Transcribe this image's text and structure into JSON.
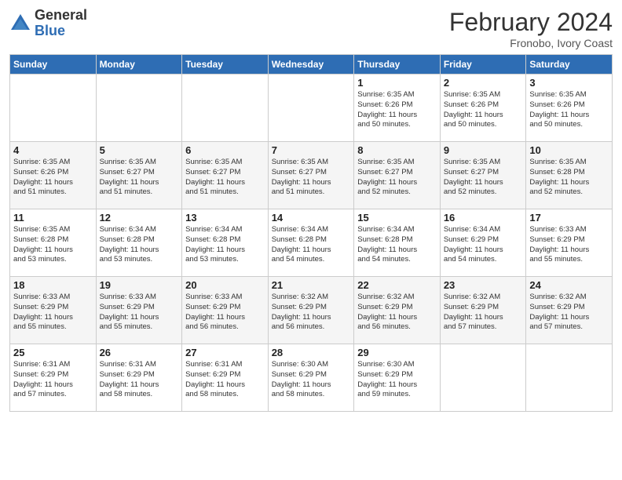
{
  "header": {
    "logo_general": "General",
    "logo_blue": "Blue",
    "month_title": "February 2024",
    "subtitle": "Fronobo, Ivory Coast"
  },
  "days_of_week": [
    "Sunday",
    "Monday",
    "Tuesday",
    "Wednesday",
    "Thursday",
    "Friday",
    "Saturday"
  ],
  "weeks": [
    [
      {
        "day": "",
        "info": ""
      },
      {
        "day": "",
        "info": ""
      },
      {
        "day": "",
        "info": ""
      },
      {
        "day": "",
        "info": ""
      },
      {
        "day": "1",
        "info": "Sunrise: 6:35 AM\nSunset: 6:26 PM\nDaylight: 11 hours\nand 50 minutes."
      },
      {
        "day": "2",
        "info": "Sunrise: 6:35 AM\nSunset: 6:26 PM\nDaylight: 11 hours\nand 50 minutes."
      },
      {
        "day": "3",
        "info": "Sunrise: 6:35 AM\nSunset: 6:26 PM\nDaylight: 11 hours\nand 50 minutes."
      }
    ],
    [
      {
        "day": "4",
        "info": "Sunrise: 6:35 AM\nSunset: 6:26 PM\nDaylight: 11 hours\nand 51 minutes."
      },
      {
        "day": "5",
        "info": "Sunrise: 6:35 AM\nSunset: 6:27 PM\nDaylight: 11 hours\nand 51 minutes."
      },
      {
        "day": "6",
        "info": "Sunrise: 6:35 AM\nSunset: 6:27 PM\nDaylight: 11 hours\nand 51 minutes."
      },
      {
        "day": "7",
        "info": "Sunrise: 6:35 AM\nSunset: 6:27 PM\nDaylight: 11 hours\nand 51 minutes."
      },
      {
        "day": "8",
        "info": "Sunrise: 6:35 AM\nSunset: 6:27 PM\nDaylight: 11 hours\nand 52 minutes."
      },
      {
        "day": "9",
        "info": "Sunrise: 6:35 AM\nSunset: 6:27 PM\nDaylight: 11 hours\nand 52 minutes."
      },
      {
        "day": "10",
        "info": "Sunrise: 6:35 AM\nSunset: 6:28 PM\nDaylight: 11 hours\nand 52 minutes."
      }
    ],
    [
      {
        "day": "11",
        "info": "Sunrise: 6:35 AM\nSunset: 6:28 PM\nDaylight: 11 hours\nand 53 minutes."
      },
      {
        "day": "12",
        "info": "Sunrise: 6:34 AM\nSunset: 6:28 PM\nDaylight: 11 hours\nand 53 minutes."
      },
      {
        "day": "13",
        "info": "Sunrise: 6:34 AM\nSunset: 6:28 PM\nDaylight: 11 hours\nand 53 minutes."
      },
      {
        "day": "14",
        "info": "Sunrise: 6:34 AM\nSunset: 6:28 PM\nDaylight: 11 hours\nand 54 minutes."
      },
      {
        "day": "15",
        "info": "Sunrise: 6:34 AM\nSunset: 6:28 PM\nDaylight: 11 hours\nand 54 minutes."
      },
      {
        "day": "16",
        "info": "Sunrise: 6:34 AM\nSunset: 6:29 PM\nDaylight: 11 hours\nand 54 minutes."
      },
      {
        "day": "17",
        "info": "Sunrise: 6:33 AM\nSunset: 6:29 PM\nDaylight: 11 hours\nand 55 minutes."
      }
    ],
    [
      {
        "day": "18",
        "info": "Sunrise: 6:33 AM\nSunset: 6:29 PM\nDaylight: 11 hours\nand 55 minutes."
      },
      {
        "day": "19",
        "info": "Sunrise: 6:33 AM\nSunset: 6:29 PM\nDaylight: 11 hours\nand 55 minutes."
      },
      {
        "day": "20",
        "info": "Sunrise: 6:33 AM\nSunset: 6:29 PM\nDaylight: 11 hours\nand 56 minutes."
      },
      {
        "day": "21",
        "info": "Sunrise: 6:32 AM\nSunset: 6:29 PM\nDaylight: 11 hours\nand 56 minutes."
      },
      {
        "day": "22",
        "info": "Sunrise: 6:32 AM\nSunset: 6:29 PM\nDaylight: 11 hours\nand 56 minutes."
      },
      {
        "day": "23",
        "info": "Sunrise: 6:32 AM\nSunset: 6:29 PM\nDaylight: 11 hours\nand 57 minutes."
      },
      {
        "day": "24",
        "info": "Sunrise: 6:32 AM\nSunset: 6:29 PM\nDaylight: 11 hours\nand 57 minutes."
      }
    ],
    [
      {
        "day": "25",
        "info": "Sunrise: 6:31 AM\nSunset: 6:29 PM\nDaylight: 11 hours\nand 57 minutes."
      },
      {
        "day": "26",
        "info": "Sunrise: 6:31 AM\nSunset: 6:29 PM\nDaylight: 11 hours\nand 58 minutes."
      },
      {
        "day": "27",
        "info": "Sunrise: 6:31 AM\nSunset: 6:29 PM\nDaylight: 11 hours\nand 58 minutes."
      },
      {
        "day": "28",
        "info": "Sunrise: 6:30 AM\nSunset: 6:29 PM\nDaylight: 11 hours\nand 58 minutes."
      },
      {
        "day": "29",
        "info": "Sunrise: 6:30 AM\nSunset: 6:29 PM\nDaylight: 11 hours\nand 59 minutes."
      },
      {
        "day": "",
        "info": ""
      },
      {
        "day": "",
        "info": ""
      }
    ]
  ]
}
